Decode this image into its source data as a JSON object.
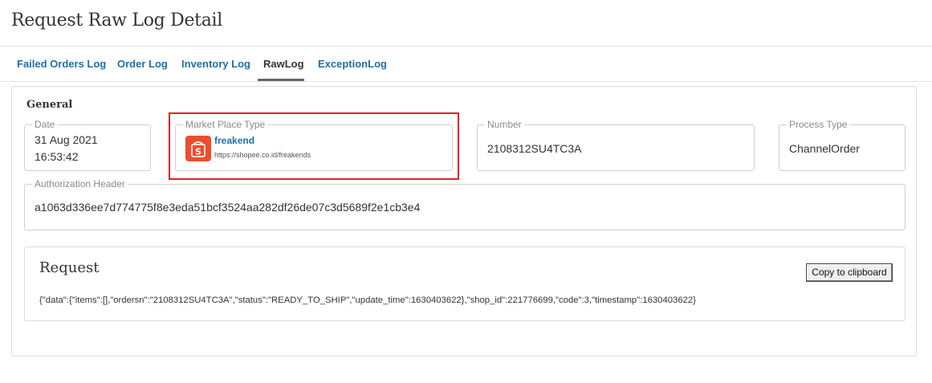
{
  "page": {
    "title": "Request Raw Log Detail"
  },
  "tabs": [
    {
      "label": "Failed Orders Log",
      "active": false
    },
    {
      "label": "Order Log",
      "active": false
    },
    {
      "label": "Inventory Log",
      "active": false
    },
    {
      "label": "RawLog",
      "active": true
    },
    {
      "label": "ExceptionLog",
      "active": false
    }
  ],
  "general": {
    "title": "General",
    "date": {
      "label": "Date",
      "value_date": "31 Aug 2021",
      "value_time": "16:53:42"
    },
    "marketplace": {
      "label": "Market Place Type",
      "shop_name": "freakend",
      "shop_url": "https://shopee.co.id/freakends",
      "logo_icon": "shopee-bag-icon",
      "logo_color": "#ee4d2d"
    },
    "number": {
      "label": "Number",
      "value": "2108312SU4TC3A"
    },
    "process_type": {
      "label": "Process Type",
      "value": "ChannelOrder"
    },
    "authorization": {
      "label": "Authorization Header",
      "value": "a1063d336ee7d774775f8e3eda51bcf3524aa282df26de07c3d5689f2e1cb3e4"
    }
  },
  "request": {
    "title": "Request",
    "copy_label": "Copy to clipboard",
    "body": "{\"data\":{\"items\":[],\"ordersn\":\"2108312SU4TC3A\",\"status\":\"READY_TO_SHIP\",\"update_time\":1630403622},\"shop_id\":221776699,\"code\":3,\"timestamp\":1630403622}"
  },
  "colors": {
    "link": "#1e6fa8",
    "highlight": "#e0232a",
    "shopee": "#ee4d2d"
  }
}
